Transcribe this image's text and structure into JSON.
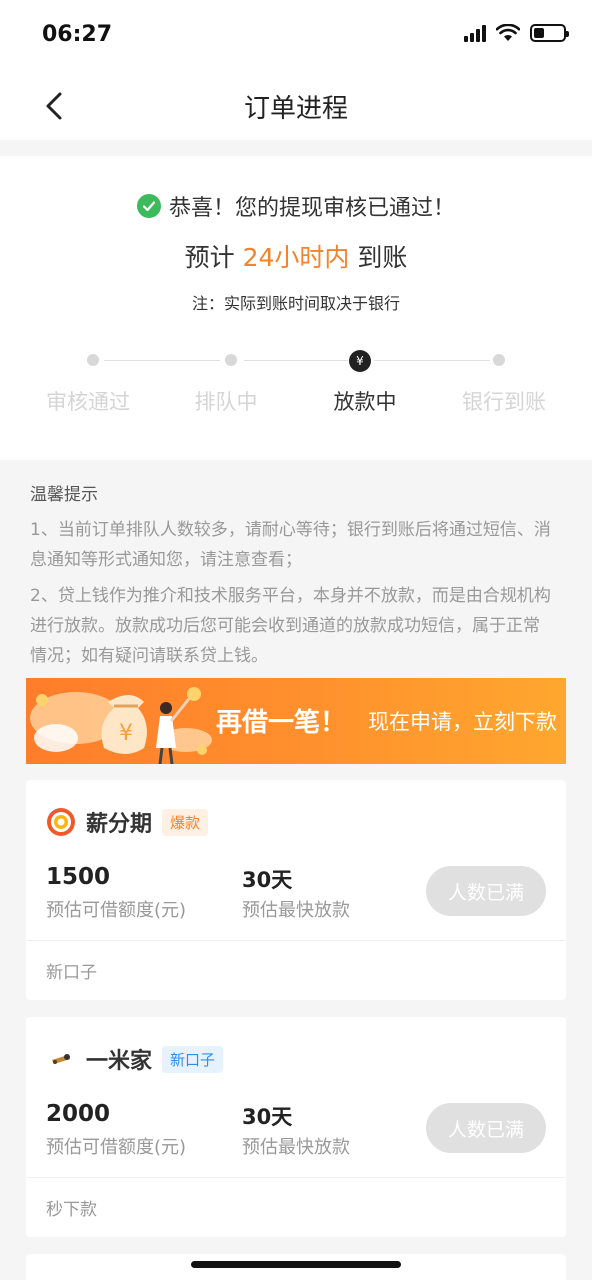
{
  "status_bar": {
    "time": "06:27"
  },
  "nav": {
    "title": "订单进程"
  },
  "status": {
    "congrats": "恭喜！您的提现审核已通过！",
    "eta_prefix": "预计",
    "eta_highlight": "24小时内",
    "eta_suffix": "到账",
    "note": "注：实际到账时间取决于银行",
    "steps": [
      {
        "label": "审核通过"
      },
      {
        "label": "排队中"
      },
      {
        "label": "放款中",
        "active": true,
        "icon": "¥"
      },
      {
        "label": "银行到账"
      }
    ]
  },
  "tips": {
    "title": "温馨提示",
    "items": [
      "1、当前订单排队人数较多，请耐心等待；银行到账后将通过短信、消息通知等形式通知您，请注意查看；",
      "2、贷上钱作为推介和技术服务平台，本身并不放款，而是由合规机构进行放款。放款成功后您可能会收到通道的放款成功短信，属于正常情况；如有疑问请联系贷上钱。"
    ]
  },
  "banner": {
    "title": "再借一笔！",
    "subtitle": "现在申请，立刻下款",
    "money_symbol": "¥"
  },
  "products": [
    {
      "name": "薪分期",
      "tag": "爆款",
      "amount": "1500",
      "amount_label": "预估可借额度(元)",
      "days": "30天",
      "days_label": "预估最快放款",
      "button": "人数已满",
      "footer": "新口子"
    },
    {
      "name": "一米家",
      "tag": "新口子",
      "amount": "2000",
      "amount_label": "预估可借额度(元)",
      "days": "30天",
      "days_label": "预估最快放款",
      "button": "人数已满",
      "footer": "秒下款"
    }
  ],
  "colors": {
    "accent": "#f5832a",
    "success": "#3dbb5c",
    "tag_blue": "#2f8fe8"
  }
}
